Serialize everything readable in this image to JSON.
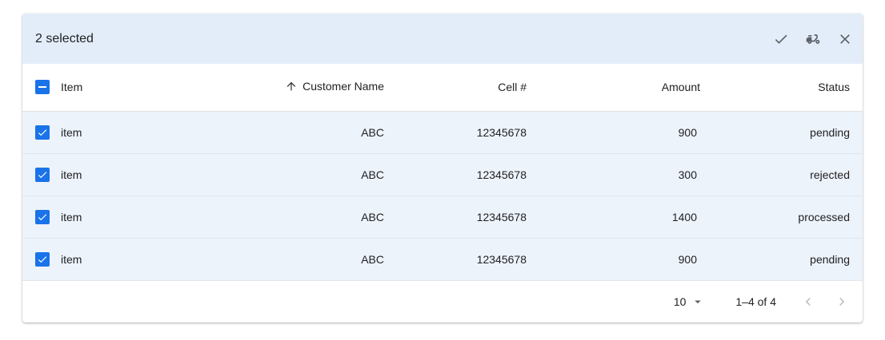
{
  "toolbar": {
    "selected_label": "2 selected",
    "actions": [
      "check-icon",
      "moped-icon",
      "close-icon"
    ]
  },
  "table": {
    "columns": [
      "Item",
      "Customer Name",
      "Cell #",
      "Amount",
      "Status"
    ],
    "sorted_column": "Customer Name",
    "sort_direction": "ascending",
    "rows": [
      {
        "item": "item",
        "customer": "ABC",
        "cell": "12345678",
        "amount": "900",
        "status": "pending"
      },
      {
        "item": "item",
        "customer": "ABC",
        "cell": "12345678",
        "amount": "300",
        "status": "rejected"
      },
      {
        "item": "item",
        "customer": "ABC",
        "cell": "12345678",
        "amount": "1400",
        "status": "processed"
      },
      {
        "item": "item",
        "customer": "ABC",
        "cell": "12345678",
        "amount": "900",
        "status": "pending"
      }
    ]
  },
  "footer": {
    "rows_per_page": "10",
    "range_label": "1–4 of 4"
  },
  "colors": {
    "accent": "#1a73e8",
    "toolbar_bg": "#e3edf9",
    "selected_row_bg": "#edf3fb"
  }
}
